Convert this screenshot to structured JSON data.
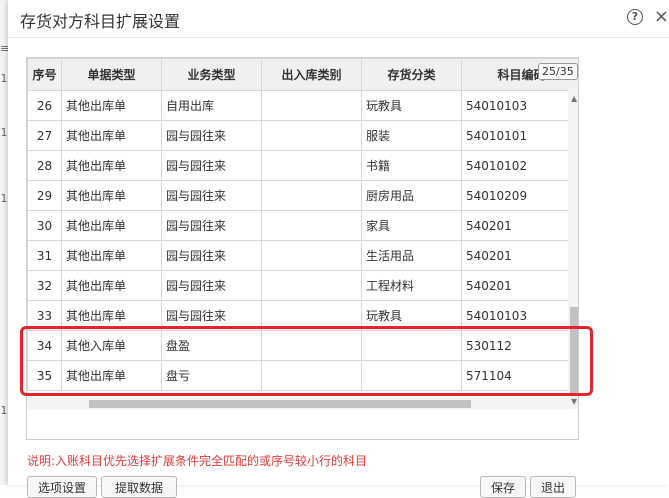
{
  "dialog": {
    "title": "存货对方科目扩展设置",
    "help_glyph": "?",
    "close_glyph": "×"
  },
  "left_edge_glyphs": [
    "≡",
    "1",
    "1",
    "1",
    "1"
  ],
  "grid": {
    "page_indicator": "25/35",
    "columns": [
      "序号",
      "单据类型",
      "业务类型",
      "出入库类别",
      "存货分类",
      "科目编码"
    ],
    "rows": [
      {
        "seq": "26",
        "doc_type": "其他出库单",
        "biz_type": "自用出库",
        "io_category": "",
        "inventory_class": "玩教具",
        "account_code": "54010103"
      },
      {
        "seq": "27",
        "doc_type": "其他出库单",
        "biz_type": "园与园往来",
        "io_category": "",
        "inventory_class": "服装",
        "account_code": "54010101"
      },
      {
        "seq": "28",
        "doc_type": "其他出库单",
        "biz_type": "园与园往来",
        "io_category": "",
        "inventory_class": "书籍",
        "account_code": "54010102"
      },
      {
        "seq": "29",
        "doc_type": "其他出库单",
        "biz_type": "园与园往来",
        "io_category": "",
        "inventory_class": "厨房用品",
        "account_code": "54010209"
      },
      {
        "seq": "30",
        "doc_type": "其他出库单",
        "biz_type": "园与园往来",
        "io_category": "",
        "inventory_class": "家具",
        "account_code": "540201"
      },
      {
        "seq": "31",
        "doc_type": "其他出库单",
        "biz_type": "园与园往来",
        "io_category": "",
        "inventory_class": "生活用品",
        "account_code": "540201"
      },
      {
        "seq": "32",
        "doc_type": "其他出库单",
        "biz_type": "园与园往来",
        "io_category": "",
        "inventory_class": "工程材料",
        "account_code": "540201"
      },
      {
        "seq": "33",
        "doc_type": "其他出库单",
        "biz_type": "园与园往来",
        "io_category": "",
        "inventory_class": "玩教具",
        "account_code": "54010103"
      },
      {
        "seq": "34",
        "doc_type": "其他入库单",
        "biz_type": "盘盈",
        "io_category": "",
        "inventory_class": "",
        "account_code": "530112"
      },
      {
        "seq": "35",
        "doc_type": "其他出库单",
        "biz_type": "盘亏",
        "io_category": "",
        "inventory_class": "",
        "account_code": "571104"
      }
    ],
    "scroll_up_glyph": "▲",
    "scroll_down_glyph": "▼"
  },
  "note": "说明:入账科目优先选择扩展条件完全匹配的或序号较小行的科目",
  "buttons": {
    "options": "选项设置",
    "fetch": "提取数据",
    "save": "保存",
    "exit": "退出"
  },
  "colors": {
    "highlight_border": "#e8232a",
    "note_text": "#e03b3b",
    "header_bg": "#f0f0f0"
  }
}
